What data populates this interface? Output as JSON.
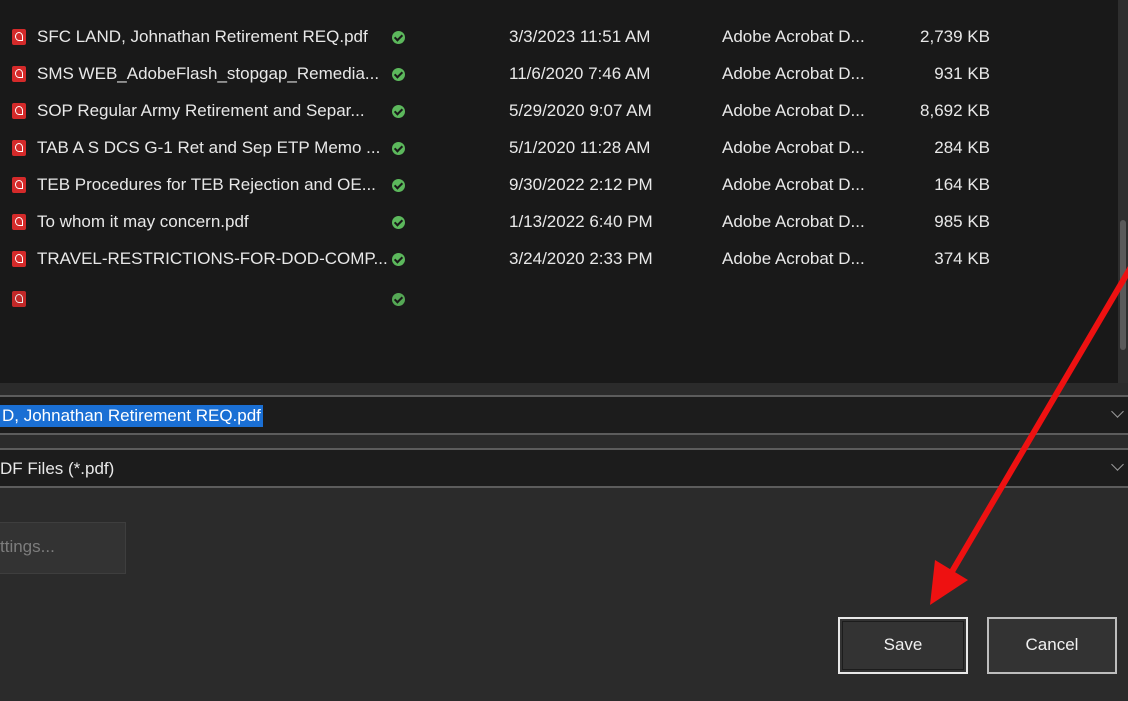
{
  "files": [
    {
      "name": "SFC LAND, Johnathan Retirement REQ.pdf",
      "date": "3/3/2023 11:51 AM",
      "type": "Adobe Acrobat D...",
      "size": "2,739 KB"
    },
    {
      "name": "SMS WEB_AdobeFlash_stopgap_Remedia...",
      "date": "11/6/2020 7:46 AM",
      "type": "Adobe Acrobat D...",
      "size": "931 KB"
    },
    {
      "name": "SOP Regular Army Retirement and Separ...",
      "date": "5/29/2020 9:07 AM",
      "type": "Adobe Acrobat D...",
      "size": "8,692 KB"
    },
    {
      "name": "TAB A S DCS G-1 Ret and Sep ETP Memo ...",
      "date": "5/1/2020 11:28 AM",
      "type": "Adobe Acrobat D...",
      "size": "284 KB"
    },
    {
      "name": "TEB  Procedures for TEB Rejection and OE...",
      "date": "9/30/2022 2:12 PM",
      "type": "Adobe Acrobat D...",
      "size": "164 KB"
    },
    {
      "name": "To whom it may concern.pdf",
      "date": "1/13/2022 6:40 PM",
      "type": "Adobe Acrobat D...",
      "size": "985 KB"
    },
    {
      "name": "TRAVEL-RESTRICTIONS-FOR-DOD-COMP...",
      "date": "3/24/2020 2:33 PM",
      "type": "Adobe Acrobat D...",
      "size": "374 KB"
    }
  ],
  "filename_value": "D, Johnathan Retirement REQ.pdf",
  "filetype_value": "DF Files (*.pdf)",
  "settings_label": "ttings...",
  "save_label": "Save",
  "cancel_label": "Cancel",
  "colors": {
    "annotation_arrow": "#ee1111",
    "selection": "#1a6fd4",
    "sync_ok": "#5cb85c"
  }
}
